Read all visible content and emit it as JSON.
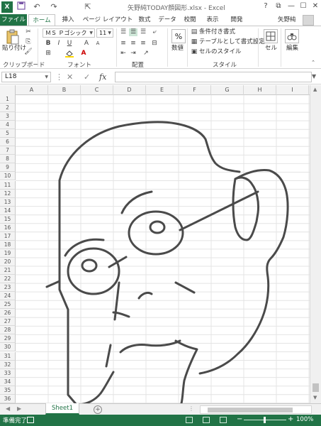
{
  "window": {
    "title": "矢野純TODAY顔図形.xlsx - Excel",
    "controls": [
      "?",
      "⧉",
      "—",
      "☐",
      "✕"
    ]
  },
  "quick_access": {
    "icons": [
      "excel-app-icon",
      "save-icon",
      "undo-icon",
      "redo-icon",
      "pointer-icon"
    ]
  },
  "tabs": [
    {
      "label": "ファイル",
      "kind": "file"
    },
    {
      "label": "ホーム",
      "kind": "active"
    },
    {
      "label": "挿入"
    },
    {
      "label": "ページ レイアウト"
    },
    {
      "label": "数式"
    },
    {
      "label": "データ"
    },
    {
      "label": "校閲"
    },
    {
      "label": "表示"
    },
    {
      "label": "開発"
    }
  ],
  "user": {
    "name": "矢野純"
  },
  "ribbon": {
    "clipboard": {
      "paste_label": "貼り付け",
      "group_label": "クリップボード"
    },
    "font": {
      "name": "ＭＳ Ｐゴシック",
      "size": "11",
      "group_label": "フォント"
    },
    "alignment": {
      "group_label": "配置"
    },
    "number": {
      "label": "数値"
    },
    "styles": {
      "conditional": "条件付き書式",
      "table": "テーブルとして書式設定",
      "cell_style": "セルのスタイル",
      "group_label": "スタイル"
    },
    "cells": {
      "label": "セル"
    },
    "editing": {
      "label": "編集"
    }
  },
  "formula_bar": {
    "name_box": "L18",
    "fx_label": "fx",
    "formula": ""
  },
  "grid": {
    "columns": [
      "A",
      "B",
      "C",
      "D",
      "E",
      "F",
      "G",
      "H",
      "I"
    ],
    "rows": [
      "1",
      "2",
      "3",
      "4",
      "5",
      "6",
      "7",
      "8",
      "9",
      "10",
      "11",
      "12",
      "13",
      "14",
      "15",
      "16",
      "17",
      "18",
      "19",
      "20",
      "21",
      "22",
      "23",
      "24",
      "25",
      "26",
      "27",
      "28",
      "29",
      "30",
      "31",
      "32",
      "33",
      "34",
      "35",
      "36"
    ],
    "drawing_color": "#4a4a4a"
  },
  "sheets": {
    "tabs": [
      "Sheet1"
    ],
    "active": "Sheet1"
  },
  "status": {
    "ready": "準備完了",
    "zoom": "100%",
    "zoom_minus": "−",
    "zoom_plus": "+"
  },
  "colors": {
    "accent": "#217346",
    "header_bg": "#f3f3f3",
    "gridline": "#e4e4e4"
  }
}
